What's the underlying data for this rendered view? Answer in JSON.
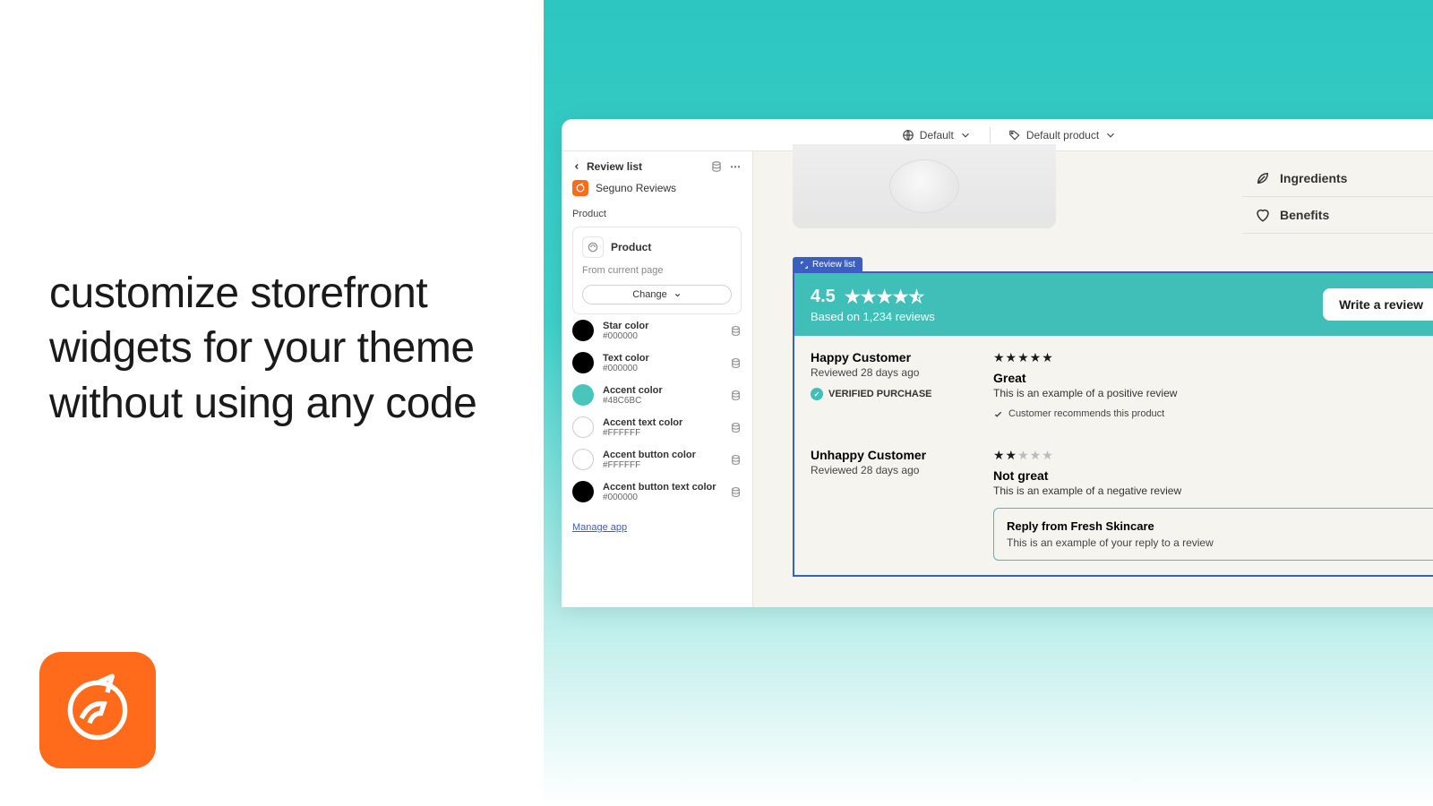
{
  "headline": "customize storefront\nwidgets for your theme\nwithout using any code",
  "topbar": {
    "item1": "Default",
    "item2": "Default product"
  },
  "sidebar": {
    "back_label": "Review list",
    "app_name": "Seguno Reviews",
    "section_label": "Product",
    "product_label": "Product",
    "caption": "From current page",
    "change_label": "Change",
    "colors": [
      {
        "label": "Star color",
        "hex": "#000000",
        "swatch": "#000000"
      },
      {
        "label": "Text color",
        "hex": "#000000",
        "swatch": "#000000"
      },
      {
        "label": "Accent color",
        "hex": "#48C6BC",
        "swatch": "#48C6BC"
      },
      {
        "label": "Accent text color",
        "hex": "#FFFFFF",
        "swatch": "#FFFFFF"
      },
      {
        "label": "Accent button color",
        "hex": "#FFFFFF",
        "swatch": "#FFFFFF"
      },
      {
        "label": "Accent button text color",
        "hex": "#000000",
        "swatch": "#000000"
      }
    ],
    "manage_link": "Manage app"
  },
  "accordion": {
    "item1": "Ingredients",
    "item2": "Benefits"
  },
  "badge": "Review list",
  "widget": {
    "rating": "4.5",
    "subline": "Based on 1,234 reviews",
    "write_label": "Write a review",
    "reviews": [
      {
        "name": "Happy Customer",
        "date": "Reviewed 28 days ago",
        "verified": "VERIFIED PURCHASE",
        "stars": 5,
        "title": "Great",
        "body": "This is an example of a positive review",
        "recommends": "Customer recommends this product"
      },
      {
        "name": "Unhappy Customer",
        "date": "Reviewed 28 days ago",
        "stars": 2,
        "title": "Not great",
        "body": "This is an example of a negative review",
        "reply_title": "Reply from Fresh Skincare",
        "reply_body": "This is an example of your reply to a review"
      }
    ]
  }
}
